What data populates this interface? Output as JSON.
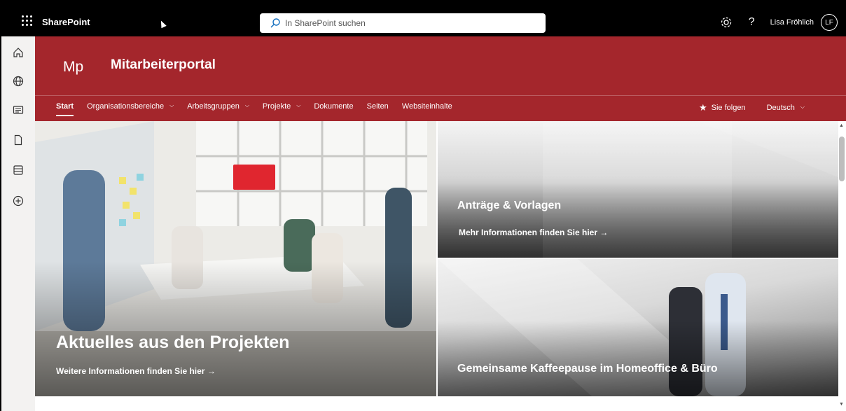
{
  "suite": {
    "brand": "SharePoint",
    "search_placeholder": "In SharePoint suchen",
    "help_label": "?",
    "user_name": "Lisa Fröhlich",
    "user_initials": "LF"
  },
  "site": {
    "logo_text": "Mp",
    "title": "Mitarbeiterportal"
  },
  "nav": {
    "items": [
      {
        "label": "Start",
        "dropdown": false
      },
      {
        "label": "Organisationsbereiche",
        "dropdown": true
      },
      {
        "label": "Arbeitsgruppen",
        "dropdown": true
      },
      {
        "label": "Projekte",
        "dropdown": true
      },
      {
        "label": "Dokumente",
        "dropdown": false
      },
      {
        "label": "Seiten",
        "dropdown": false
      },
      {
        "label": "Websiteinhalte",
        "dropdown": false
      }
    ],
    "chevron": "⌵",
    "follow_label": "Sie folgen",
    "language_label": "Deutsch"
  },
  "hero": {
    "main_title": "Aktuelles aus den Projekten",
    "main_link": "Weitere Informationen finden Sie hier →",
    "top_right_title": "Anträge & Vorlagen",
    "top_right_link": "Mehr Informationen finden Sie hier →",
    "bottom_right_title": "Gemeinsame Kaffeepause im Homeoffice & Büro"
  },
  "appbar_icons": [
    "home-icon",
    "globe-icon",
    "news-icon",
    "document-icon",
    "list-icon",
    "add-icon"
  ]
}
